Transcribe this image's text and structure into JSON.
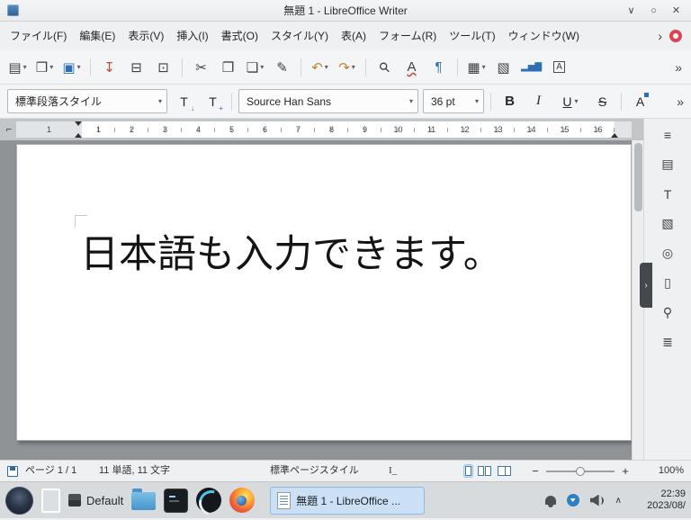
{
  "ui": {
    "caret": "▾",
    "overflow": "»",
    "menu_overflow": "›",
    "accent_color": "#3daee9"
  },
  "window": {
    "title": "無題 1 - LibreOffice Writer",
    "minimize_glyph": "∨",
    "maximize_glyph": "○",
    "close_glyph": "✕"
  },
  "menubar": {
    "items": [
      {
        "name": "menu-file",
        "label": "ファイル(F)"
      },
      {
        "name": "menu-edit",
        "label": "編集(E)"
      },
      {
        "name": "menu-view",
        "label": "表示(V)"
      },
      {
        "name": "menu-insert",
        "label": "挿入(I)"
      },
      {
        "name": "menu-format",
        "label": "書式(O)"
      },
      {
        "name": "menu-styles",
        "label": "スタイル(Y)"
      },
      {
        "name": "menu-table",
        "label": "表(A)"
      },
      {
        "name": "menu-form",
        "label": "フォーム(R)"
      },
      {
        "name": "menu-tools",
        "label": "ツール(T)"
      },
      {
        "name": "menu-window",
        "label": "ウィンドウ(W)"
      }
    ]
  },
  "toolbar": {
    "items": [
      {
        "name": "new-document-button",
        "glyph": "▤",
        "dd": "▾",
        "interactable": true
      },
      {
        "name": "open-file-button",
        "glyph": "❒",
        "dd": "▾",
        "interactable": true
      },
      {
        "name": "save-button",
        "cls": "ic-save",
        "glyph": "▣",
        "dd": "▾",
        "interactable": true
      },
      {
        "name": "separator",
        "type": "separator",
        "interactable": false
      },
      {
        "name": "export-pdf-button",
        "cls": "ic-pdf",
        "glyph": "↧",
        "interactable": true
      },
      {
        "name": "print-button",
        "glyph": "⊟",
        "interactable": true
      },
      {
        "name": "print-preview-button",
        "glyph": "⊡",
        "interactable": true
      },
      {
        "name": "separator",
        "type": "separator",
        "interactable": false
      },
      {
        "name": "cut-button",
        "glyph": "✂",
        "interactable": true
      },
      {
        "name": "copy-button",
        "glyph": "❐",
        "interactable": true
      },
      {
        "name": "paste-button",
        "glyph": "❏",
        "dd": "▾",
        "interactable": true
      },
      {
        "name": "clone-formatting-button",
        "glyph": "✎",
        "interactable": true
      },
      {
        "name": "separator",
        "type": "separator",
        "interactable": false
      },
      {
        "name": "undo-button",
        "cls": "ic-undo",
        "glyph": "↶",
        "dd": "▾",
        "interactable": true
      },
      {
        "name": "redo-button",
        "cls": "ic-redo",
        "glyph": "↷",
        "dd": "▾",
        "interactable": true
      },
      {
        "name": "separator",
        "type": "separator",
        "interactable": false
      },
      {
        "name": "find-replace-button",
        "cls": "ic-find",
        "glyph": "⚲",
        "interactable": true
      },
      {
        "name": "spelling-button",
        "cls": "ic-spell",
        "glyph": "A",
        "interactable": true
      },
      {
        "name": "formatting-marks-button",
        "cls": "ic-marks",
        "glyph": "¶",
        "interactable": true
      },
      {
        "name": "separator",
        "type": "separator",
        "interactable": false
      },
      {
        "name": "insert-table-button",
        "glyph": "▦",
        "dd": "▾",
        "interactable": true
      },
      {
        "name": "insert-image-button",
        "glyph": "▧",
        "interactable": true
      },
      {
        "name": "insert-chart-button",
        "cls": "ic-chart",
        "glyph": "▂▅▇",
        "interactable": true
      },
      {
        "name": "insert-textbox-button",
        "cls": "ic-textbox",
        "glyph": "A",
        "interactable": true
      }
    ]
  },
  "formatbar": {
    "paragraph_style": "標準段落スタイル",
    "update_style_glyph": "T",
    "update_style_badge": "↓",
    "new_style_glyph": "T",
    "new_style_badge": "+",
    "font_name": "Source Han Sans",
    "font_size": "36 pt",
    "bold": "B",
    "italic": "I",
    "underline": "U",
    "strikethrough": "S",
    "superscript": "A"
  },
  "ruler": {
    "tab_selector_glyph": "⌐",
    "margin_number": "1",
    "numbers": [
      1,
      2,
      3,
      4,
      5,
      6,
      7,
      8,
      9,
      10,
      11,
      12,
      13,
      14,
      15,
      16
    ]
  },
  "document": {
    "text": "日本語も入力できます。"
  },
  "sidebar": {
    "collapse_glyph": "›",
    "items": [
      {
        "name": "sidebar-settings-icon",
        "glyph": "≡"
      },
      {
        "name": "sidebar-properties-icon",
        "glyph": "▤"
      },
      {
        "name": "sidebar-styles-icon",
        "glyph": "T"
      },
      {
        "name": "sidebar-gallery-icon",
        "glyph": "▧"
      },
      {
        "name": "sidebar-navigator-icon",
        "glyph": "◎"
      },
      {
        "name": "sidebar-page-icon",
        "glyph": "▯"
      },
      {
        "name": "sidebar-style-inspector-icon",
        "glyph": "⚲"
      },
      {
        "name": "sidebar-accessibility-icon",
        "glyph": "≣"
      }
    ]
  },
  "statusbar": {
    "page_info": "ページ 1 / 1",
    "word_count": "11 単語, 11 文字",
    "page_style": "標準ページスタイル",
    "selection_mode_glyph": "I_",
    "zoom_out": "−",
    "zoom_in": "+",
    "zoom_level": "100%"
  },
  "taskbar": {
    "activity_label": "Default",
    "active_task_label": "無題 1 - LibreOffice ...",
    "tray_expand_glyph": "∧",
    "clock_time": "22:39",
    "clock_date": "2023/08/"
  }
}
